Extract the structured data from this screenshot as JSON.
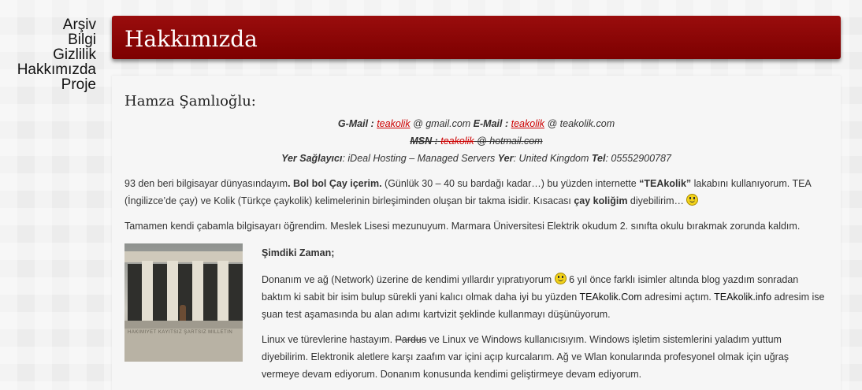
{
  "sidebar": {
    "items": [
      {
        "label": "Arşiv"
      },
      {
        "label": "Bilgi"
      },
      {
        "label": "Gizlilik"
      },
      {
        "label": "Hakkımızda"
      },
      {
        "label": "Proje"
      }
    ]
  },
  "header": {
    "title": "Hakkımızda"
  },
  "content": {
    "person_name": "Hamza Şamlıoğlu:",
    "contact": {
      "gmail_label": "G-Mail :",
      "gmail_user": "teakolik",
      "gmail_domain": "@ gmail.com",
      "email_label": "E-Mail :",
      "email_user": "teakolik",
      "email_domain": "@ teakolik.com",
      "msn_label": "MSN :",
      "msn_user": "teakolik",
      "msn_domain": "@ hotmail.com",
      "host_label": "Yer Sağlayıcı",
      "host_value": ": iDeal Hosting – Managed Servers",
      "location_label": "Yer",
      "location_value": ": United Kingdom",
      "phone_label": "Tel",
      "phone_value": ": 05552900787"
    },
    "intro": {
      "p1_a": "93 den beri bilgisayar dünyasındayım",
      "p1_b": ". Bol bol Çay içerim.",
      "p1_c": " (Günlük 30 – 40 su bardağı kadar…) bu yüzden internette ",
      "p1_d": "“TEAkolik”",
      "p1_e": " lakabını kullanıyorum. TEA (İngilizce’de çay) ve Kolik (Türkçe çaykolik) kelimelerinin birleşiminden oluşan bir takma isidir. Kısacası ",
      "p1_f": "çay koliğim",
      "p1_g": " diyebilirim… ",
      "p2": "Tamamen kendi çabamla bilgisayarı öğrendim. Meslek Lisesi mezunuyum. Marmara Üniversitesi Elektrik okudum 2. sınıfta okulu bırakmak zorunda kaldım."
    },
    "photo_engraving": "HAKIMIYET KAYITSIZ ŞARTSIZ MILLETIN",
    "now": {
      "heading": "Şimdiki Zaman;",
      "p1_a": "Donanım ve ağ (Network) üzerine de kendimi yıllardır yıpratıyorum ",
      "p1_b": " 6 yıl önce farklı isimler altında blog yazdım sonradan baktım ki sabit bir isim bulup sürekli yani kalıcı olmak daha iyi bu yüzden ",
      "p1_link1": "TEAkolik.Com",
      "p1_c": " adresimi  açtım.  ",
      "p1_link2": "TEAkolik.info",
      "p1_d": " adresim ise şuan test aşamasında bu alan adımı kartvizit şeklinde kullanmayı düşünüyorum.",
      "p2_a": "Linux ve türevlerine hastayım. ",
      "p2_strike": "Pardus",
      "p2_b": " ve Linux ve Windows kullanıcısıyım. Windows işletim sistemlerini yaladım yuttum diyebilirim.   Elektronik aletlere karşı zaafım var içini açıp kurcalarım.  Ağ ve Wlan konularında profesyonel olmak için uğraş vermeye devam ediyorum. Donanım konusunda kendimi geliştirmeye devam ediyorum."
    }
  }
}
